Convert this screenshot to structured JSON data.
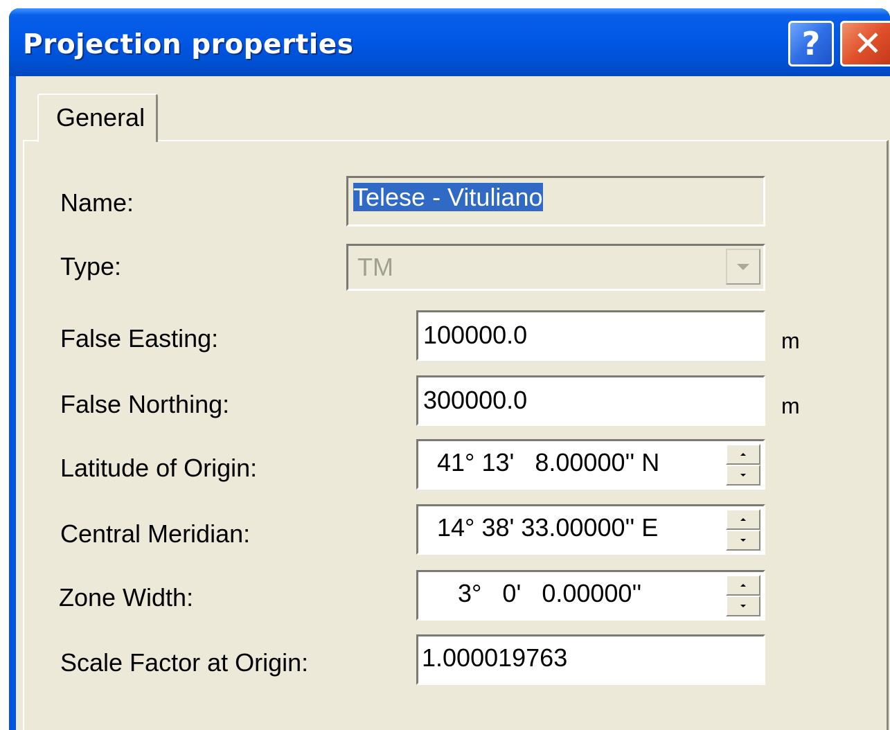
{
  "window": {
    "title": "Projection properties",
    "help_label": "?",
    "close_label": "✕"
  },
  "tabs": [
    {
      "label": "General",
      "active": true
    }
  ],
  "form": {
    "name": {
      "label": "Name:",
      "value": "Telese - Vituliano"
    },
    "type": {
      "label": "Type:",
      "value": "TM"
    },
    "false_easting": {
      "label": "False Easting:",
      "value": "100000.0",
      "unit": "m"
    },
    "false_northing": {
      "label": "False Northing:",
      "value": "300000.0",
      "unit": "m"
    },
    "latitude_of_origin": {
      "label": "Latitude of Origin:",
      "value": "41° 13'   8.00000'' N"
    },
    "central_meridian": {
      "label": "Central Meridian:",
      "value": "14° 38' 33.00000'' E"
    },
    "zone_width": {
      "label": "Zone Width:",
      "value": "3°   0'   0.00000''"
    },
    "scale_factor": {
      "label": "Scale Factor at Origin:",
      "value": "1.000019763"
    }
  },
  "colors": {
    "title_bar": "#0058e6",
    "dialog_bg": "#ece9d8",
    "selection": "#316ac5",
    "close_button": "#e0502a"
  }
}
